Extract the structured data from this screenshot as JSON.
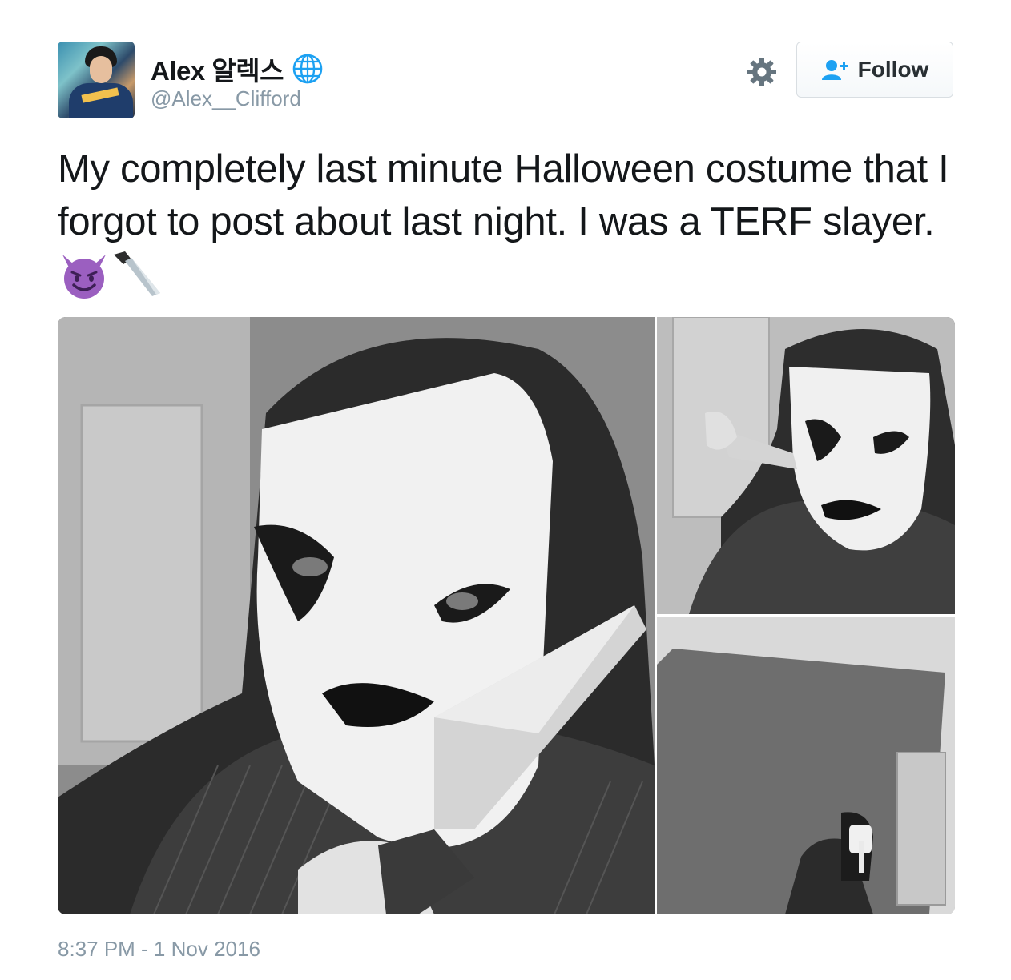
{
  "user": {
    "display_name": "Alex 알렉스",
    "handle": "@Alex__Clifford"
  },
  "actions": {
    "follow_label": "Follow"
  },
  "tweet": {
    "text": "My completely last minute Halloween costume that I forgot to post about last night. I was a TERF slayer.",
    "emojis": [
      "smiling-imp-emoji",
      "knife-emoji"
    ],
    "timestamp": "8:37 PM - 1 Nov 2016"
  },
  "icons": [
    "globe-icon",
    "gear-icon",
    "follow-user-icon"
  ],
  "colors": {
    "text": "#14171a",
    "secondary_text": "#8899a6",
    "accent_blue": "#1da1f2",
    "emoji_purple": "#9b5fc0"
  }
}
